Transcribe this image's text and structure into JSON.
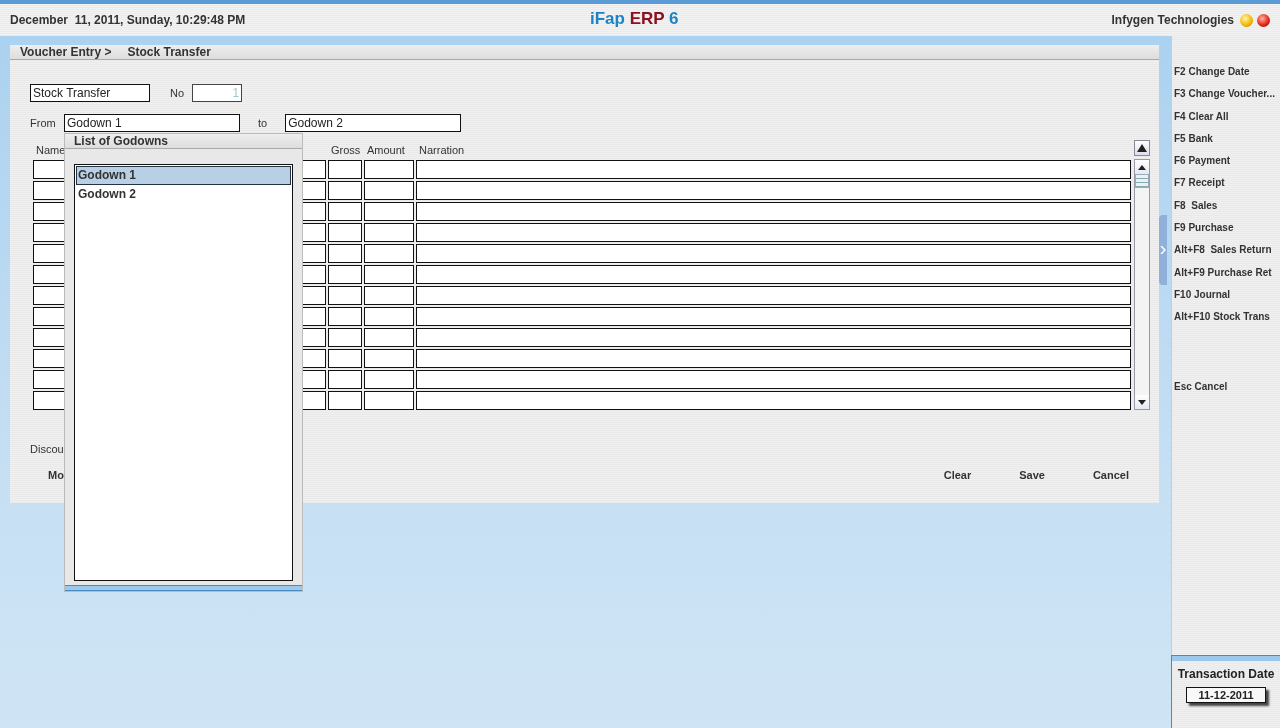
{
  "header": {
    "datetime": "December  11, 2011, Sunday, 10:29:48 PM",
    "app_title": {
      "name": "iFap",
      "edition": "ERP",
      "version": "6"
    },
    "company": "Infygen Technologies"
  },
  "breadcrumb": [
    "Voucher Entry >",
    "Stock Transfer"
  ],
  "form": {
    "voucher_type": "Stock Transfer",
    "no_label": "No",
    "no_value": "1",
    "no_disabled": true,
    "from_label": "From",
    "from_value": "Godown 1",
    "to_label": "to",
    "to_value": "Godown 2"
  },
  "table": {
    "columns": [
      {
        "label": "Name"
      },
      {
        "label": "Gross"
      },
      {
        "label": "Amount"
      },
      {
        "label": "Narration"
      }
    ]
  },
  "discount_label": "Discou",
  "more_button": "Mo",
  "buttons": [
    "Clear",
    "Save",
    "Cancel"
  ],
  "popup": {
    "title": "List of Godowns",
    "items": [
      {
        "label": "Godown 1",
        "selected": true
      },
      {
        "label": "Godown 2",
        "selected": false
      }
    ]
  },
  "shortcuts": [
    "F2 Change Date",
    "F3 Change Voucher...",
    "F4 Clear All",
    "F5 Bank",
    "F6 Payment",
    "F7 Receipt",
    "F8  Sales",
    "F9 Purchase",
    "Alt+F8  Sales Return",
    "Alt+F9 Purchase Ret",
    "F10 Journal",
    "Alt+F10 Stock Trans"
  ],
  "cancel_shortcut": "Esc Cancel",
  "transaction_date": {
    "label": "Transaction Date",
    "value": "11-12-2011"
  }
}
